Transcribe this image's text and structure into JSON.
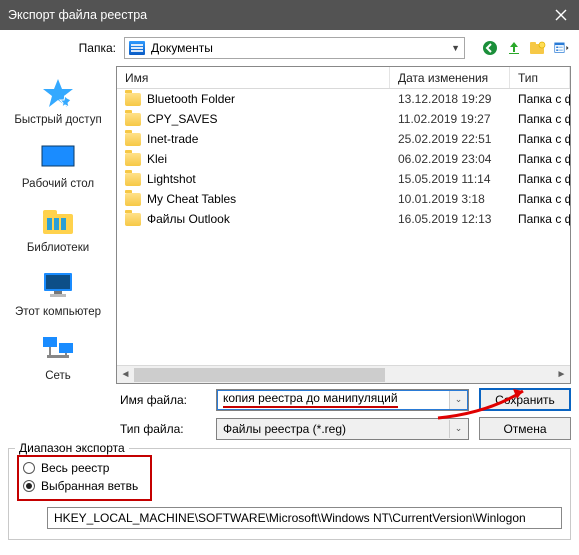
{
  "window": {
    "title": "Экспорт файла реестра"
  },
  "topbar": {
    "folder_label": "Папка:",
    "current_folder": "Документы"
  },
  "columns": {
    "name": "Имя",
    "date": "Дата изменения",
    "type": "Тип"
  },
  "files": [
    {
      "name": "Bluetooth Folder",
      "date": "13.12.2018 19:29",
      "type": "Папка с ф"
    },
    {
      "name": "CPY_SAVES",
      "date": "11.02.2019 19:27",
      "type": "Папка с ф"
    },
    {
      "name": "Inet-trade",
      "date": "25.02.2019 22:51",
      "type": "Папка с ф"
    },
    {
      "name": "Klei",
      "date": "06.02.2019 23:04",
      "type": "Папка с ф"
    },
    {
      "name": "Lightshot",
      "date": "15.05.2019 11:14",
      "type": "Папка с ф"
    },
    {
      "name": "My Cheat Tables",
      "date": "10.01.2019 3:18",
      "type": "Папка с ф"
    },
    {
      "name": "Файлы Outlook",
      "date": "16.05.2019 12:13",
      "type": "Папка с ф"
    }
  ],
  "places": {
    "quick": "Быстрый доступ",
    "desktop": "Рабочий стол",
    "libs": "Библиотеки",
    "thispc": "Этот компьютер",
    "network": "Сеть"
  },
  "form": {
    "filename_label": "Имя файла:",
    "filename_value": "копия реестра до манипуляций",
    "filetype_label": "Тип файла:",
    "filetype_value": "Файлы реестра (*.reg)",
    "save": "Сохранить",
    "cancel": "Отмена"
  },
  "export": {
    "legend": "Диапазон экспорта",
    "whole": "Весь реестр",
    "selected": "Выбранная ветвь",
    "path": "HKEY_LOCAL_MACHINE\\SOFTWARE\\Microsoft\\Windows NT\\CurrentVersion\\Winlogon"
  }
}
